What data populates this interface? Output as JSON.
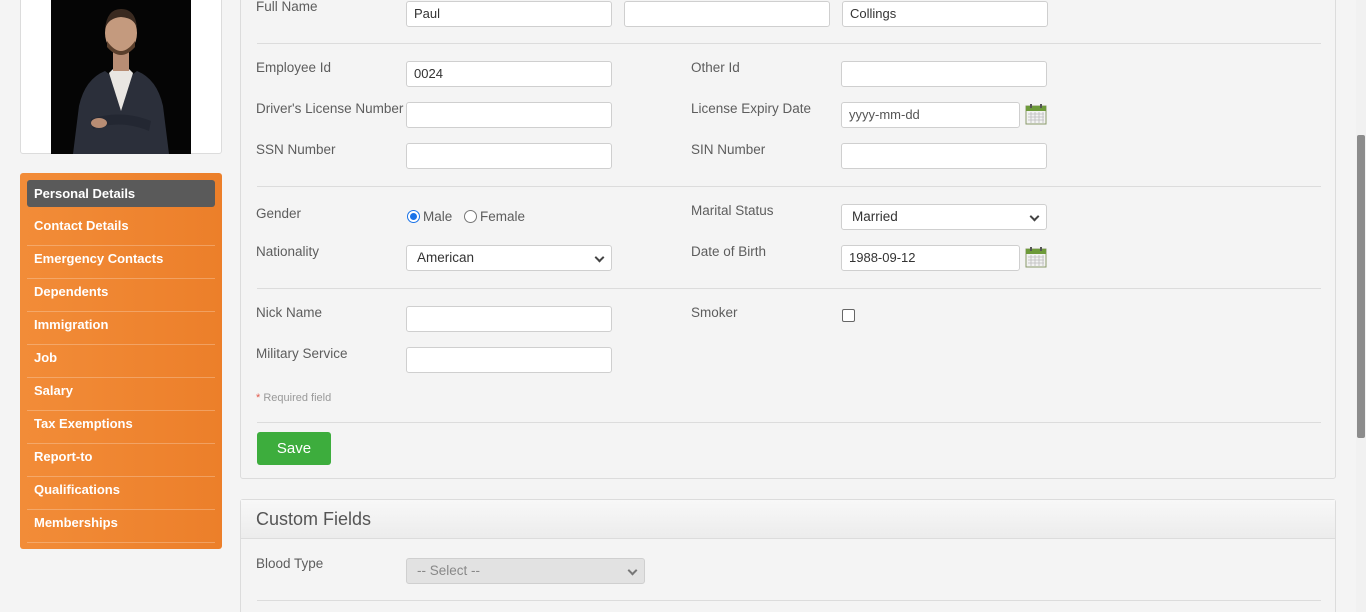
{
  "sidebar": {
    "items": [
      {
        "label": "Personal Details"
      },
      {
        "label": "Contact Details"
      },
      {
        "label": "Emergency Contacts"
      },
      {
        "label": "Dependents"
      },
      {
        "label": "Immigration"
      },
      {
        "label": "Job"
      },
      {
        "label": "Salary"
      },
      {
        "label": "Tax Exemptions"
      },
      {
        "label": "Report-to"
      },
      {
        "label": "Qualifications"
      },
      {
        "label": "Memberships"
      }
    ]
  },
  "form": {
    "full_name_label": "Full Name",
    "first_name": "Paul",
    "middle_name": "",
    "last_name": "Collings",
    "employee_id_label": "Employee Id",
    "employee_id": "0024",
    "other_id_label": "Other Id",
    "other_id": "",
    "license_label": "Driver's License Number",
    "license": "",
    "license_expiry_label": "License Expiry Date",
    "license_expiry": "yyyy-mm-dd",
    "ssn_label": "SSN Number",
    "ssn": "",
    "sin_label": "SIN Number",
    "sin": "",
    "gender_label": "Gender",
    "gender_male": "Male",
    "gender_female": "Female",
    "gender_selected": "Male",
    "marital_label": "Marital Status",
    "marital_value": "Married",
    "nationality_label": "Nationality",
    "nationality_value": "American",
    "dob_label": "Date of Birth",
    "dob": "1988-09-12",
    "nickname_label": "Nick Name",
    "nickname": "",
    "smoker_label": "Smoker",
    "smoker_checked": false,
    "military_label": "Military Service",
    "military": "",
    "required_star": "*",
    "required_text": " Required field",
    "save_label": "Save"
  },
  "custom_fields": {
    "title": "Custom Fields",
    "blood_type_label": "Blood Type",
    "blood_type_value": "-- Select --"
  },
  "colors": {
    "sidebar": "#f28c38",
    "sidebar_active": "#5a5a5a",
    "save": "#3dad3d"
  },
  "icons": {
    "calendar": "calendar-icon",
    "dropdown": "chevron-down-icon"
  }
}
